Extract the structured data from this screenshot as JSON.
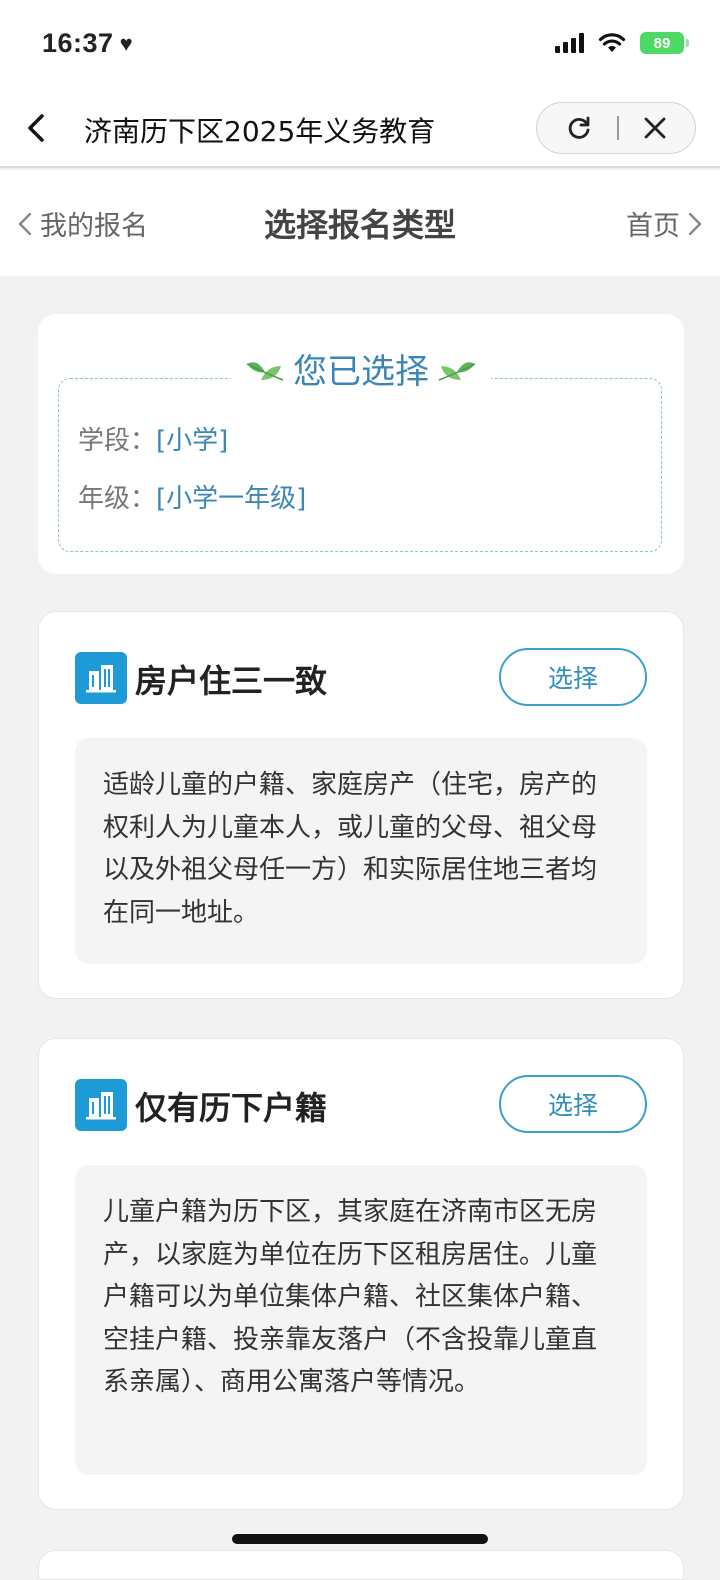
{
  "status_bar": {
    "time": "16:37",
    "battery": "89",
    "icons": [
      "heart-icon",
      "signal-icon",
      "wifi-icon",
      "battery-icon"
    ]
  },
  "browser": {
    "title": "济南历下区2025年义务教育",
    "icons": [
      "back-icon",
      "refresh-icon",
      "close-icon"
    ]
  },
  "nav": {
    "back_label": "我的报名",
    "title": "选择报名类型",
    "home_label": "首页"
  },
  "selection": {
    "heading": "您已选择",
    "rows": [
      {
        "label": "学段：",
        "value": "[小学]"
      },
      {
        "label": "年级：",
        "value": "[小学一年级]"
      }
    ]
  },
  "types": [
    {
      "title": "房户住三一致",
      "button": "选择",
      "description": "适龄儿童的户籍、家庭房产（住宅，房产的权利人为儿童本人，或儿童的父母、祖父母以及外祖父母任一方）和实际居住地三者均在同一地址。"
    },
    {
      "title": "仅有历下户籍",
      "button": "选择",
      "description": "儿童户籍为历下区，其家庭在济南市区无房产，以家庭为单位在历下区租房居住。儿童户籍可以为单位集体户籍、社区集体户籍、空挂户籍、投亲靠友落户（不含投靠儿童直系亲属）、商用公寓落户等情况。"
    }
  ],
  "colors": {
    "accent": "#3b86b7",
    "button_border": "#3aa0c9",
    "icon_bg": "#1e9ad6",
    "battery": "#4cd964"
  }
}
